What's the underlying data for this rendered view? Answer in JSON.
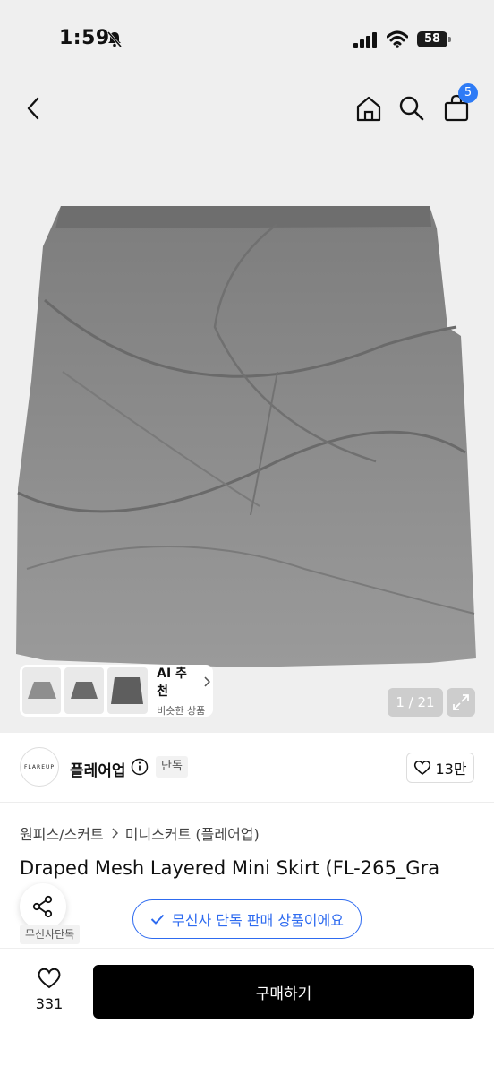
{
  "status_bar": {
    "time": "1:59",
    "battery": "58"
  },
  "nav": {
    "cart_count": "5"
  },
  "gallery": {
    "ai_title": "AI 추천",
    "ai_sub": "비슷한 상품",
    "counter": "1 / 21",
    "thumbnail_count": 3
  },
  "brand": {
    "logo_text": "FLAREUP",
    "name": "플레어업",
    "exclusive_tag": "단독",
    "like_count": "13만"
  },
  "breadcrumb": {
    "category": "원피스/스커트",
    "subcategory": "미니스커트 (플레어업)"
  },
  "product": {
    "title": "Draped Mesh Layered Mini Skirt (FL-265_Gra",
    "exclusive_notice": "무신사 단독 판매 상품이에요",
    "musinsa_tag": "무신사단독"
  },
  "bottom": {
    "wish_count": "331",
    "buy_label": "구매하기"
  },
  "colors": {
    "accent_blue": "#2e6bf0",
    "badge_blue": "#2e7bf6",
    "buy_bg": "#000000",
    "skirt_grey": "#8a8a8a"
  }
}
